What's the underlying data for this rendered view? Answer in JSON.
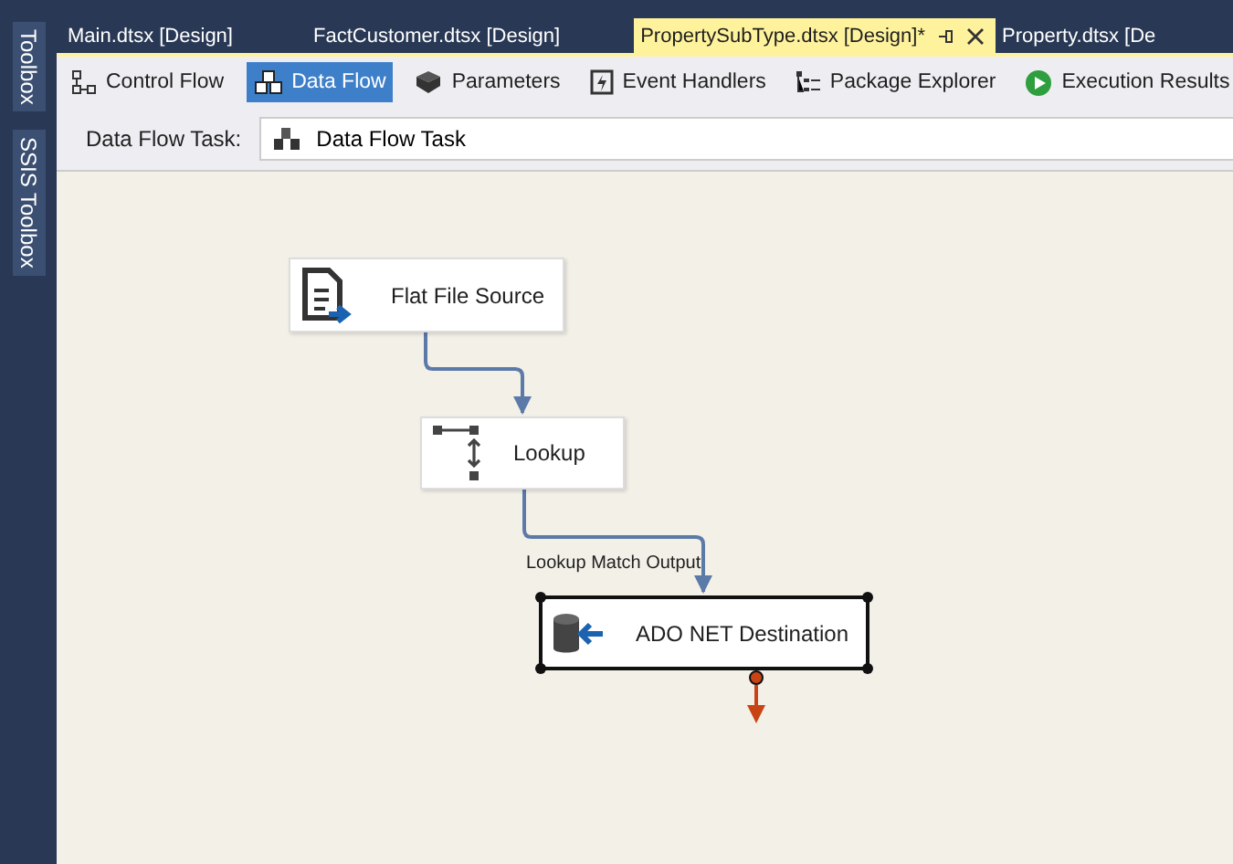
{
  "side_panel": {
    "items": [
      "Toolbox",
      "SSIS Toolbox"
    ]
  },
  "tabs": [
    {
      "label": "Main.dtsx [Design]",
      "selected": false
    },
    {
      "label": "FactCustomer.dtsx [Design]",
      "selected": false
    },
    {
      "label": "PropertySubType.dtsx [Design]*",
      "selected": true
    },
    {
      "label": "Property.dtsx [De",
      "selected": false
    }
  ],
  "toolbar": [
    {
      "label": "Control Flow",
      "kind": "control",
      "selected": false
    },
    {
      "label": "Data Flow",
      "kind": "dataflow",
      "selected": true
    },
    {
      "label": "Parameters",
      "kind": "parameters",
      "selected": false
    },
    {
      "label": "Event Handlers",
      "kind": "events",
      "selected": false
    },
    {
      "label": "Package Explorer",
      "kind": "explorer",
      "selected": false
    },
    {
      "label": "Execution Results",
      "kind": "results",
      "selected": false
    }
  ],
  "task": {
    "label": "Data Flow Task:",
    "value": "Data Flow Task"
  },
  "nodes": [
    {
      "label": "Flat File Source",
      "kind": "source",
      "selected": false
    },
    {
      "label": "Lookup",
      "kind": "lookup",
      "selected": false,
      "output_label": "Lookup Match Output"
    },
    {
      "label": "ADO NET Destination",
      "kind": "destination",
      "selected": true
    }
  ]
}
